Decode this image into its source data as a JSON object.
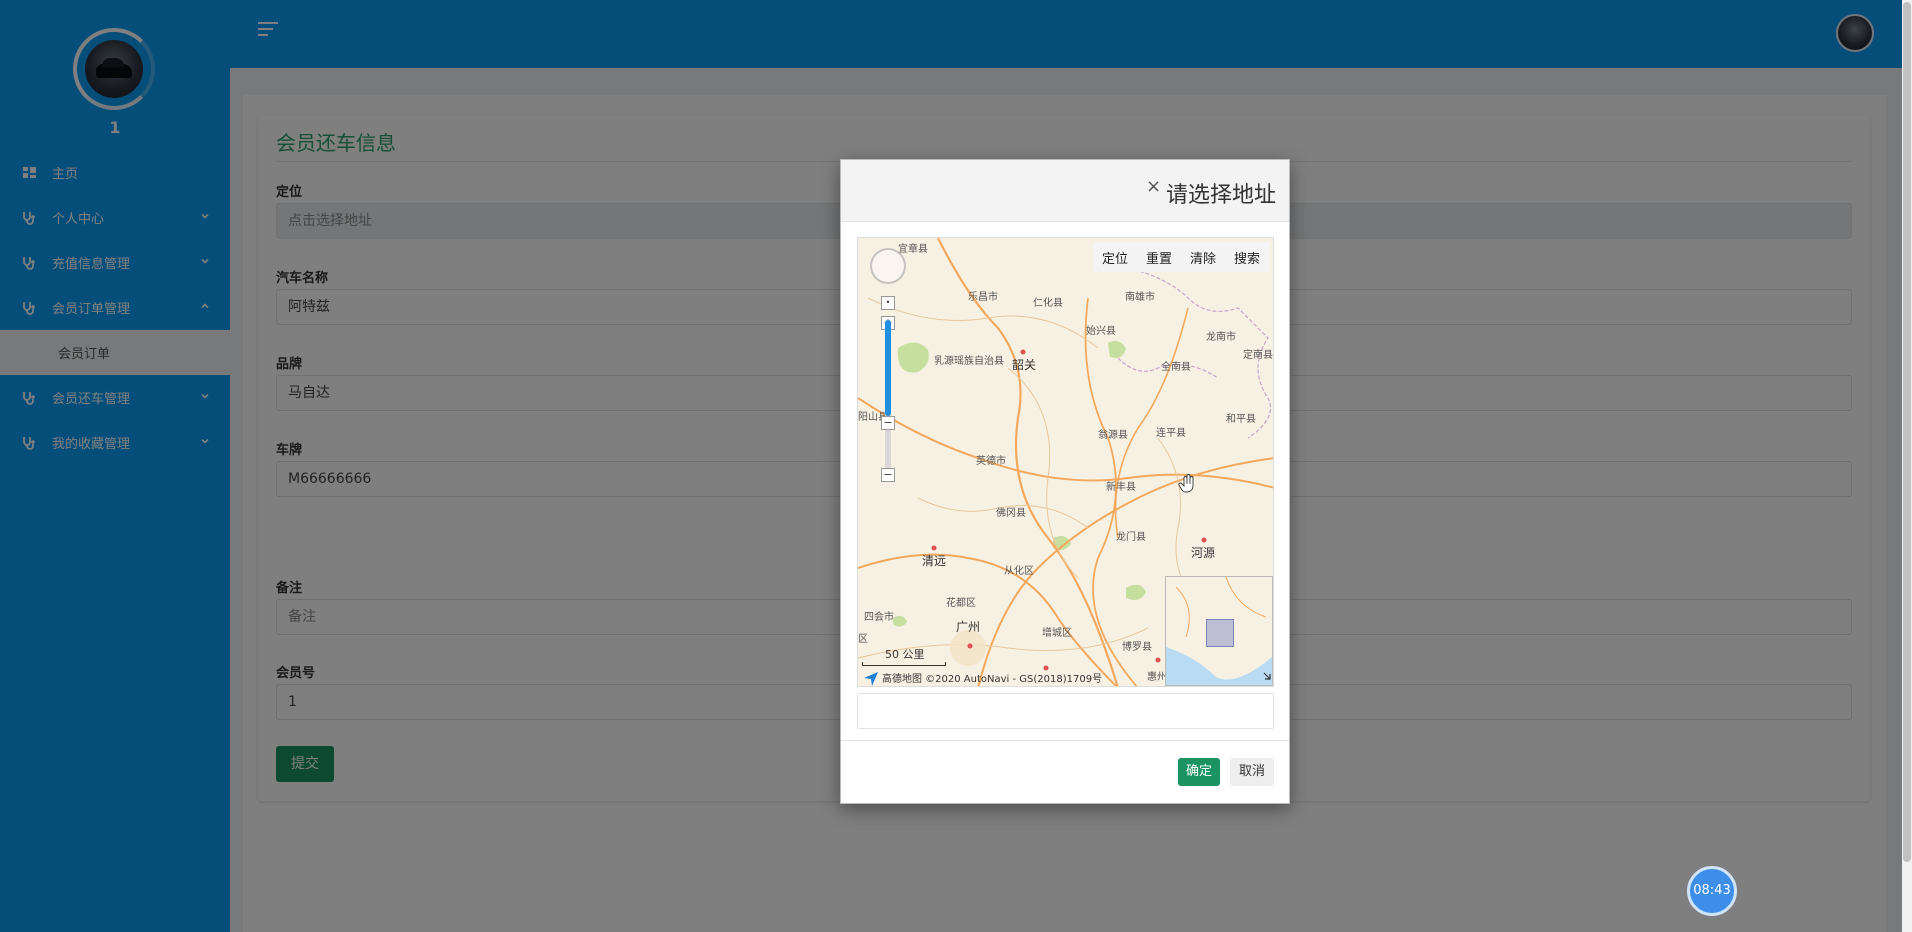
{
  "sidebar": {
    "user_name": "1",
    "menu": [
      {
        "label": "主页",
        "icon": "dashboard-icon",
        "expandable": false
      },
      {
        "label": "个人中心",
        "icon": "stethoscope-icon",
        "expandable": true,
        "expanded": false
      },
      {
        "label": "充值信息管理",
        "icon": "stethoscope-icon",
        "expandable": true,
        "expanded": false
      },
      {
        "label": "会员订单管理",
        "icon": "stethoscope-icon",
        "expandable": true,
        "expanded": true
      },
      {
        "label": "会员订单",
        "submenu": true
      },
      {
        "label": "会员还车管理",
        "icon": "stethoscope-icon",
        "expandable": true,
        "expanded": false
      },
      {
        "label": "我的收藏管理",
        "icon": "stethoscope-icon",
        "expandable": true,
        "expanded": false
      }
    ]
  },
  "form": {
    "title": "会员还车信息",
    "fields": {
      "location": {
        "label": "定位",
        "placeholder": "点击选择地址"
      },
      "car_name": {
        "label": "汽车名称",
        "value": "阿特兹"
      },
      "brand": {
        "label": "品牌",
        "value": "马自达"
      },
      "plate": {
        "label": "车牌",
        "value": "M66666666"
      },
      "remark": {
        "label": "备注",
        "placeholder": "备注"
      },
      "member_no": {
        "label": "会员号",
        "value": "1"
      }
    },
    "submit_label": "提交"
  },
  "modal": {
    "title": "请选择地址",
    "close_glyph": "×",
    "map": {
      "toolbar": [
        "定位",
        "重置",
        "清除",
        "搜索"
      ],
      "zoom_in": "+",
      "zoom_out": "−",
      "places": [
        {
          "name": "宜章县",
          "big": false
        },
        {
          "name": "乐昌市",
          "big": false
        },
        {
          "name": "仁化县",
          "big": false
        },
        {
          "name": "南雄市",
          "big": false
        },
        {
          "name": "始兴县",
          "big": false
        },
        {
          "name": "龙南市",
          "big": false
        },
        {
          "name": "乳源瑶族自治县",
          "big": false
        },
        {
          "name": "韶关",
          "big": true
        },
        {
          "name": "全南县",
          "big": false
        },
        {
          "name": "定南县",
          "big": false
        },
        {
          "name": "阳山县",
          "big": false
        },
        {
          "name": "和平县",
          "big": false
        },
        {
          "name": "翁源县",
          "big": false
        },
        {
          "name": "连平县",
          "big": false
        },
        {
          "name": "英德市",
          "big": false
        },
        {
          "name": "新丰县",
          "big": false
        },
        {
          "name": "佛冈县",
          "big": false
        },
        {
          "name": "龙门县",
          "big": false
        },
        {
          "name": "清远",
          "big": true
        },
        {
          "name": "河源",
          "big": true
        },
        {
          "name": "从化区",
          "big": false
        },
        {
          "name": "花都区",
          "big": false
        },
        {
          "name": "四会市",
          "big": false
        },
        {
          "name": "广州",
          "big": true
        },
        {
          "name": "增城区",
          "big": false
        },
        {
          "name": "博罗县",
          "big": false
        },
        {
          "name": "惠州",
          "big": false
        },
        {
          "name": "区",
          "big": false
        }
      ],
      "scale": "50 公里",
      "copyright": "高德地图  ©2020 AutoNavi - GS(2018)1709号"
    },
    "ok_label": "确定",
    "cancel_label": "取消"
  },
  "clock": "08:43"
}
